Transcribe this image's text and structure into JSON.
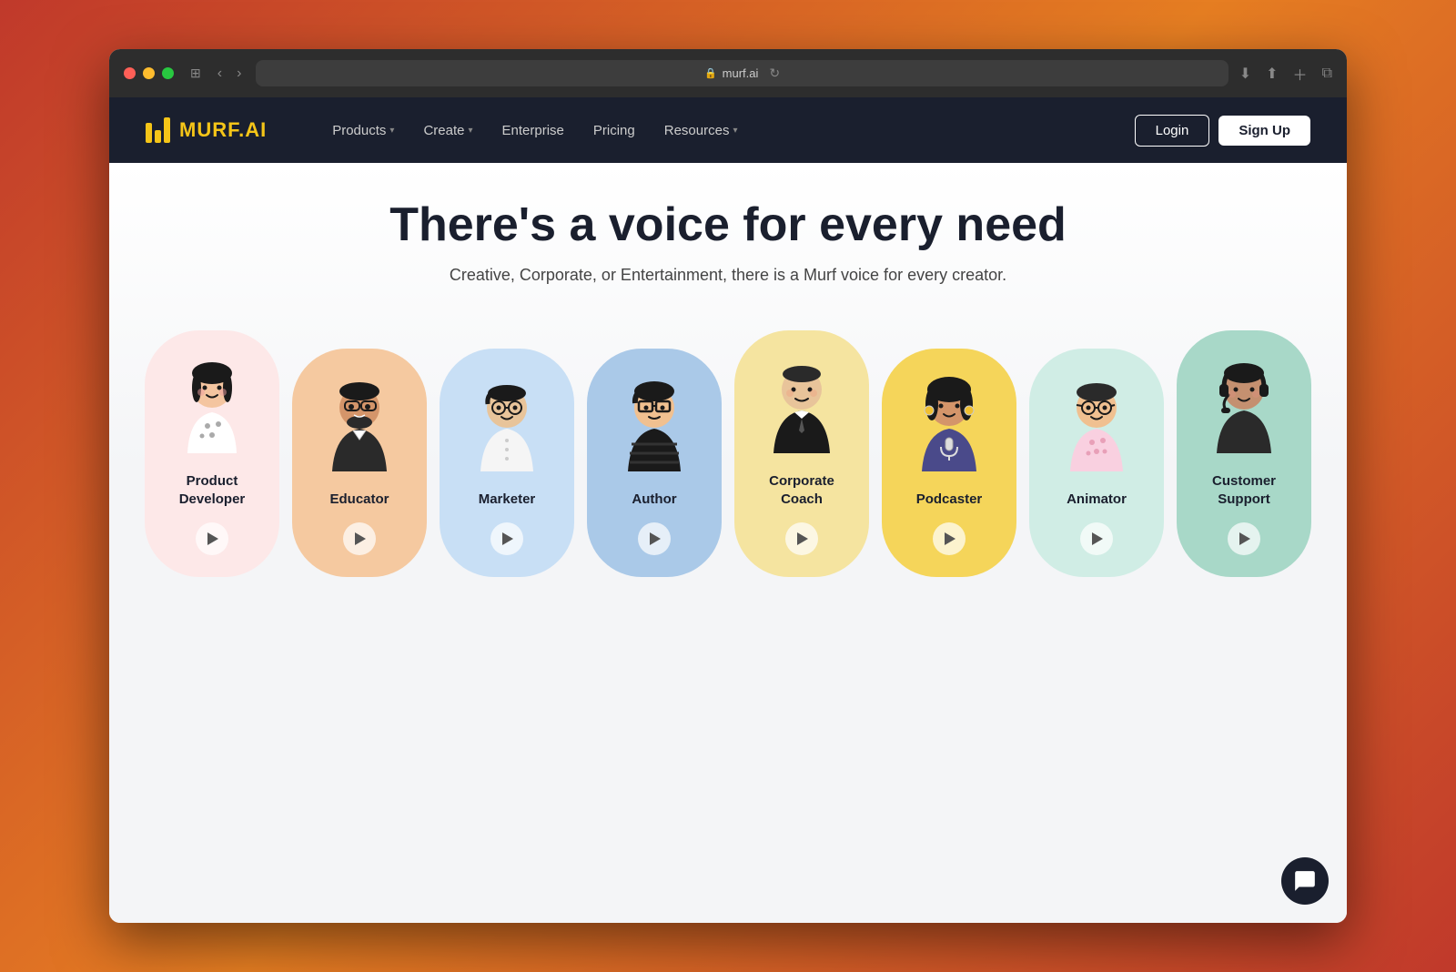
{
  "browser": {
    "url": "murf.ai",
    "back_label": "‹",
    "forward_label": "›"
  },
  "header": {
    "logo_text": "MURF.",
    "logo_ai": "AI",
    "nav_items": [
      {
        "label": "Products",
        "has_dropdown": true
      },
      {
        "label": "Create",
        "has_dropdown": true
      },
      {
        "label": "Enterprise",
        "has_dropdown": false
      },
      {
        "label": "Pricing",
        "has_dropdown": false
      },
      {
        "label": "Resources",
        "has_dropdown": true
      }
    ],
    "login_label": "Login",
    "signup_label": "Sign Up"
  },
  "hero": {
    "title": "There's a voice for every need",
    "subtitle": "Creative, Corporate, or Entertainment, there is a Murf voice for every creator."
  },
  "personas": [
    {
      "name": "Product Developer",
      "card_color": "card-pink",
      "id": "product-developer"
    },
    {
      "name": "Educator",
      "card_color": "card-peach",
      "id": "educator"
    },
    {
      "name": "Marketer",
      "card_color": "card-blue-light",
      "id": "marketer"
    },
    {
      "name": "Author",
      "card_color": "card-blue-mid",
      "id": "author"
    },
    {
      "name": "Corporate Coach",
      "card_color": "card-yellow",
      "id": "corporate-coach"
    },
    {
      "name": "Podcaster",
      "card_color": "card-yellow-bright",
      "id": "podcaster"
    },
    {
      "name": "Animator",
      "card_color": "card-mint-light",
      "id": "animator"
    },
    {
      "name": "Customer Support",
      "card_color": "card-green-mint",
      "id": "customer-support"
    }
  ]
}
